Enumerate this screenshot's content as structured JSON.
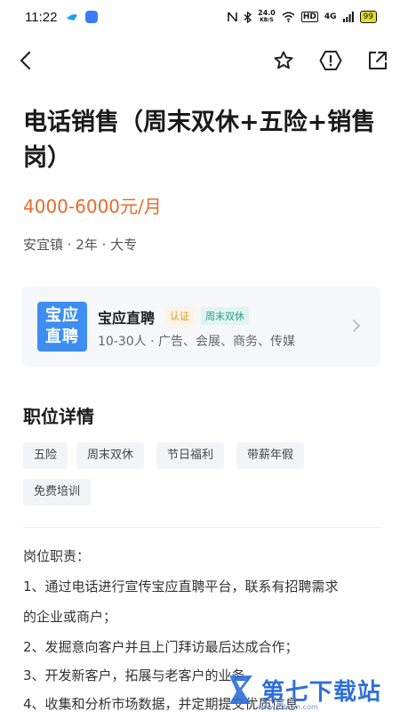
{
  "status_bar": {
    "time": "11:22",
    "net_speed_top": "24.0",
    "net_speed_bottom": "KB/S",
    "hd": "HD",
    "signal": "4G",
    "battery": "99"
  },
  "nav": {
    "back_icon": "back-chevron-icon",
    "favorite_icon": "star-icon",
    "report_icon": "warning-icon",
    "share_icon": "share-icon"
  },
  "job": {
    "title": "电话销售（周末双休+五险+销售岗）",
    "salary": "4000-6000元/月",
    "meta": "安宜镇 · 2年 · 大专"
  },
  "company": {
    "logo_line1": "宝应",
    "logo_line2": "直聘",
    "name": "宝应直聘",
    "tag_verified": "认证",
    "tag_weekend": "周末双休",
    "info": "10-30人 · 广告、会展、商务、传媒",
    "brand_color": "#3d8ef0"
  },
  "details": {
    "section_title": "职位详情",
    "benefits": [
      "五险",
      "周末双休",
      "节日福利",
      "带薪年假",
      "免费培训"
    ]
  },
  "description": {
    "lines": [
      "岗位职责：",
      "1、通过电话进行宣传宝应直聘平台，联系有招聘需求",
      "的企业或商户；",
      "2、发掘意向客户并且上门拜访最后达成合作；",
      "3、开发新客户，拓展与老客户的业务，",
      "4、收集和分析市场数据，并定期提交优质信息"
    ]
  },
  "watermark": {
    "text": "第七下载站",
    "url": "www.7down.com"
  },
  "colors": {
    "salary": "#e8692c",
    "verified_tag": "#d39a2d",
    "weekend_tag": "#2b9c88"
  }
}
